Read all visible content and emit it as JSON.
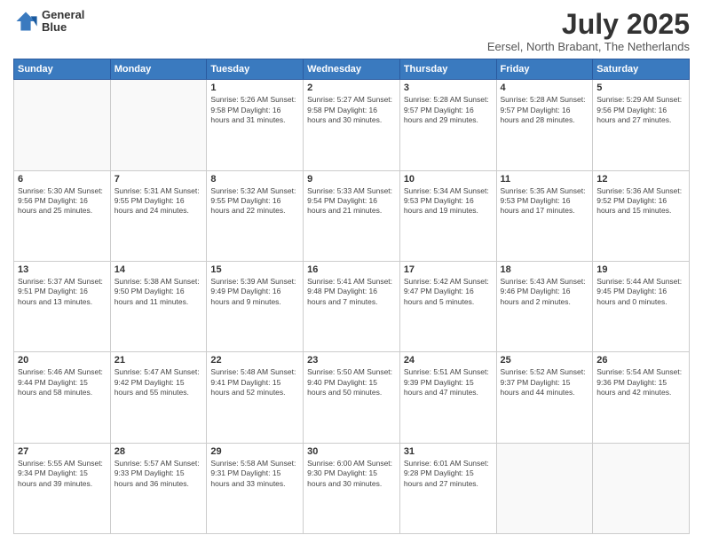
{
  "logo": {
    "line1": "General",
    "line2": "Blue"
  },
  "title": "July 2025",
  "subtitle": "Eersel, North Brabant, The Netherlands",
  "headers": [
    "Sunday",
    "Monday",
    "Tuesday",
    "Wednesday",
    "Thursday",
    "Friday",
    "Saturday"
  ],
  "weeks": [
    [
      {
        "num": "",
        "info": ""
      },
      {
        "num": "",
        "info": ""
      },
      {
        "num": "1",
        "info": "Sunrise: 5:26 AM\nSunset: 9:58 PM\nDaylight: 16 hours\nand 31 minutes."
      },
      {
        "num": "2",
        "info": "Sunrise: 5:27 AM\nSunset: 9:58 PM\nDaylight: 16 hours\nand 30 minutes."
      },
      {
        "num": "3",
        "info": "Sunrise: 5:28 AM\nSunset: 9:57 PM\nDaylight: 16 hours\nand 29 minutes."
      },
      {
        "num": "4",
        "info": "Sunrise: 5:28 AM\nSunset: 9:57 PM\nDaylight: 16 hours\nand 28 minutes."
      },
      {
        "num": "5",
        "info": "Sunrise: 5:29 AM\nSunset: 9:56 PM\nDaylight: 16 hours\nand 27 minutes."
      }
    ],
    [
      {
        "num": "6",
        "info": "Sunrise: 5:30 AM\nSunset: 9:56 PM\nDaylight: 16 hours\nand 25 minutes."
      },
      {
        "num": "7",
        "info": "Sunrise: 5:31 AM\nSunset: 9:55 PM\nDaylight: 16 hours\nand 24 minutes."
      },
      {
        "num": "8",
        "info": "Sunrise: 5:32 AM\nSunset: 9:55 PM\nDaylight: 16 hours\nand 22 minutes."
      },
      {
        "num": "9",
        "info": "Sunrise: 5:33 AM\nSunset: 9:54 PM\nDaylight: 16 hours\nand 21 minutes."
      },
      {
        "num": "10",
        "info": "Sunrise: 5:34 AM\nSunset: 9:53 PM\nDaylight: 16 hours\nand 19 minutes."
      },
      {
        "num": "11",
        "info": "Sunrise: 5:35 AM\nSunset: 9:53 PM\nDaylight: 16 hours\nand 17 minutes."
      },
      {
        "num": "12",
        "info": "Sunrise: 5:36 AM\nSunset: 9:52 PM\nDaylight: 16 hours\nand 15 minutes."
      }
    ],
    [
      {
        "num": "13",
        "info": "Sunrise: 5:37 AM\nSunset: 9:51 PM\nDaylight: 16 hours\nand 13 minutes."
      },
      {
        "num": "14",
        "info": "Sunrise: 5:38 AM\nSunset: 9:50 PM\nDaylight: 16 hours\nand 11 minutes."
      },
      {
        "num": "15",
        "info": "Sunrise: 5:39 AM\nSunset: 9:49 PM\nDaylight: 16 hours\nand 9 minutes."
      },
      {
        "num": "16",
        "info": "Sunrise: 5:41 AM\nSunset: 9:48 PM\nDaylight: 16 hours\nand 7 minutes."
      },
      {
        "num": "17",
        "info": "Sunrise: 5:42 AM\nSunset: 9:47 PM\nDaylight: 16 hours\nand 5 minutes."
      },
      {
        "num": "18",
        "info": "Sunrise: 5:43 AM\nSunset: 9:46 PM\nDaylight: 16 hours\nand 2 minutes."
      },
      {
        "num": "19",
        "info": "Sunrise: 5:44 AM\nSunset: 9:45 PM\nDaylight: 16 hours\nand 0 minutes."
      }
    ],
    [
      {
        "num": "20",
        "info": "Sunrise: 5:46 AM\nSunset: 9:44 PM\nDaylight: 15 hours\nand 58 minutes."
      },
      {
        "num": "21",
        "info": "Sunrise: 5:47 AM\nSunset: 9:42 PM\nDaylight: 15 hours\nand 55 minutes."
      },
      {
        "num": "22",
        "info": "Sunrise: 5:48 AM\nSunset: 9:41 PM\nDaylight: 15 hours\nand 52 minutes."
      },
      {
        "num": "23",
        "info": "Sunrise: 5:50 AM\nSunset: 9:40 PM\nDaylight: 15 hours\nand 50 minutes."
      },
      {
        "num": "24",
        "info": "Sunrise: 5:51 AM\nSunset: 9:39 PM\nDaylight: 15 hours\nand 47 minutes."
      },
      {
        "num": "25",
        "info": "Sunrise: 5:52 AM\nSunset: 9:37 PM\nDaylight: 15 hours\nand 44 minutes."
      },
      {
        "num": "26",
        "info": "Sunrise: 5:54 AM\nSunset: 9:36 PM\nDaylight: 15 hours\nand 42 minutes."
      }
    ],
    [
      {
        "num": "27",
        "info": "Sunrise: 5:55 AM\nSunset: 9:34 PM\nDaylight: 15 hours\nand 39 minutes."
      },
      {
        "num": "28",
        "info": "Sunrise: 5:57 AM\nSunset: 9:33 PM\nDaylight: 15 hours\nand 36 minutes."
      },
      {
        "num": "29",
        "info": "Sunrise: 5:58 AM\nSunset: 9:31 PM\nDaylight: 15 hours\nand 33 minutes."
      },
      {
        "num": "30",
        "info": "Sunrise: 6:00 AM\nSunset: 9:30 PM\nDaylight: 15 hours\nand 30 minutes."
      },
      {
        "num": "31",
        "info": "Sunrise: 6:01 AM\nSunset: 9:28 PM\nDaylight: 15 hours\nand 27 minutes."
      },
      {
        "num": "",
        "info": ""
      },
      {
        "num": "",
        "info": ""
      }
    ]
  ]
}
